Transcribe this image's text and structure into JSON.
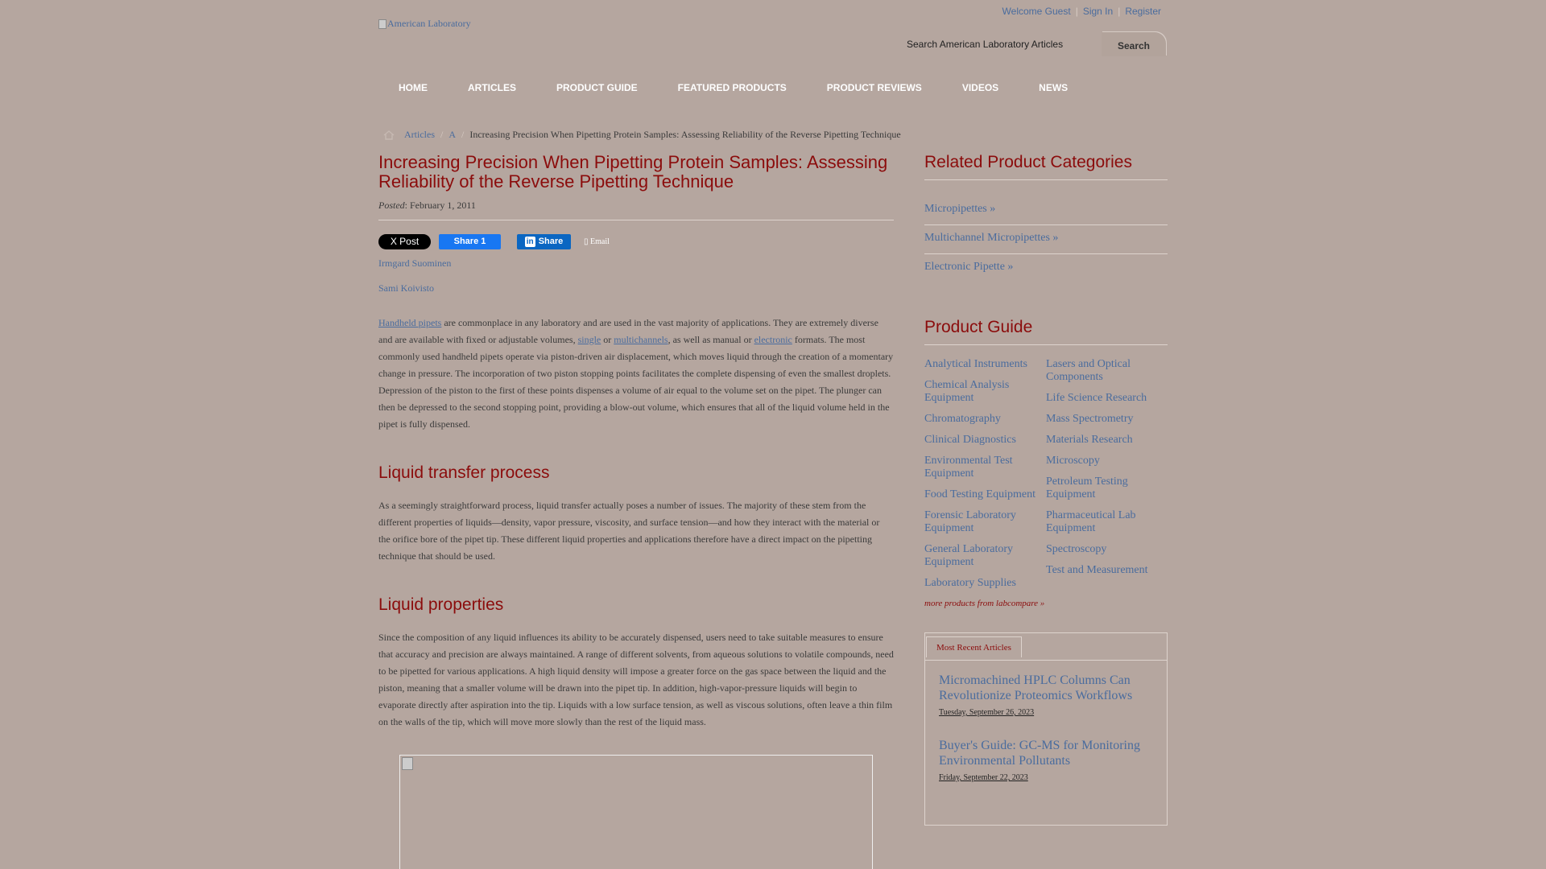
{
  "header": {
    "welcome": "Welcome Guest",
    "sign_in": "Sign In",
    "register": "Register",
    "logo_alt": "American Laboratory",
    "search_placeholder": "Search American Laboratory Articles",
    "search_button": "Search"
  },
  "nav": [
    {
      "label": "HOME"
    },
    {
      "label": "ARTICLES"
    },
    {
      "label": "PRODUCT GUIDE"
    },
    {
      "label": "FEATURED PRODUCTS"
    },
    {
      "label": "PRODUCT REVIEWS"
    },
    {
      "label": "VIDEOS"
    },
    {
      "label": "NEWS"
    }
  ],
  "breadcrumb": {
    "articles": "Articles",
    "letter": "A",
    "current": "Increasing Precision When Pipetting Protein Samples: Assessing Reliability of the Reverse Pipetting Technique"
  },
  "article": {
    "title": "Increasing Precision When Pipetting Protein Samples: Assessing Reliability of the Reverse Pipetting Technique",
    "posted_label": "Posted",
    "posted_date": ": February 1, 2011",
    "share": {
      "x_label": "X Post",
      "fb_label": "Share 1",
      "linkedin_label": "Share",
      "email_label": "Email"
    },
    "authors": [
      "Irmgard Suominen",
      "Sami Koivisto"
    ],
    "intro": {
      "link1": "Handheld pipets",
      "t1": " are commonplace in any laboratory and are used in the vast majority of applications. They are extremely diverse and are available with fixed or adjustable volumes, ",
      "link2": "single",
      "t2": " or ",
      "link3": "multichannels",
      "t3": ", as well as manual or ",
      "link4": "electronic",
      "t4": " formats. The most commonly used handheld pipets operate via piston-driven air displacement, which moves liquid through the creation of a momentary change in pressure. The incorporation of two piston stopping points facilitates the complete dispensing of even the smallest droplets. Depression of the piston to the first of these points dispenses a volume of air equal to the volume set on the pipet. The plunger can then be depressed to the second stopping point, providing a blow-out volume, which ensures that all of the liquid volume held in the pipet is fully dispensed."
    },
    "section1_heading": "Liquid transfer process",
    "section1_text": "As a seemingly straightforward process, liquid transfer actually poses a number of issues. The majority of these stem from the different properties of liquids—density, vapor pressure, viscosity, and surface tension—and how they interact with the material or the orifice bore of the pipet tip. These different liquid properties and applications therefore have a direct impact on the pipetting technique that should be used.",
    "section2_heading": "Liquid properties",
    "section2_text": "Since the composition of any liquid influences its ability to be accurately dispensed, users need to take suitable measures to ensure that accuracy and precision are always maintained. A range of different solvents, from aqueous solutions to volatile compounds, need to be pipetted for various applications. A high liquid density will impose a greater force on the gas space between the liquid and the piston, meaning that a smaller volume will be drawn into the pipet tip. In addition, high-vapor-pressure liquids will begin to evaporate directly after aspiration into the tip. Liquids with a low surface tension, as well as viscous solutions, often leave a thin film on the walls of the tip, which will move more slowly than the rest of the liquid mass."
  },
  "sidebar": {
    "related_heading": "Related Product Categories",
    "related": [
      "Micropipettes »",
      "Multichannel Micropipettes »",
      "Electronic Pipette »"
    ],
    "product_guide_heading": "Product Guide",
    "guide_col1": [
      "Analytical Instruments",
      "Chemical Analysis Equipment",
      "Chromatography",
      "Clinical Diagnostics",
      "Environmental Test Equipment",
      "Food Testing Equipment",
      "Forensic Laboratory Equipment",
      "General Laboratory Equipment",
      "Laboratory Supplies"
    ],
    "guide_col2": [
      "Lasers and Optical Components",
      "Life Science Research",
      "Mass Spectrometry",
      "Materials Research",
      "Microscopy",
      "Petroleum Testing Equipment",
      "Pharmaceutical Lab Equipment",
      "Spectroscopy",
      "Test and Measurement"
    ],
    "more_products": "more products from labcompare »",
    "recent_tab": "Most Recent Articles",
    "recent": [
      {
        "title": "Micromachined HPLC Columns Can Revolutionize Proteomics Workflows",
        "date": "Tuesday, September 26, 2023"
      },
      {
        "title": "Buyer's Guide: GC-MS for Monitoring Environmental Pollutants",
        "date": "Friday, September 22, 2023"
      }
    ]
  }
}
